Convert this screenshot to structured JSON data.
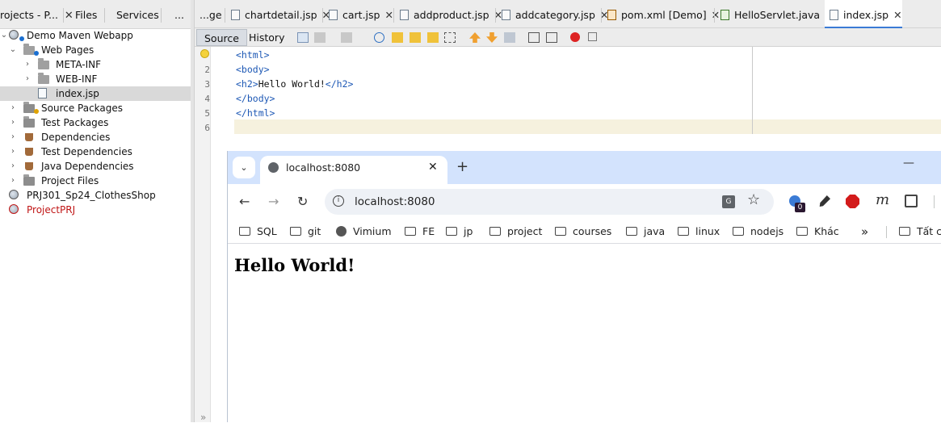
{
  "left_panel": {
    "tabs": [
      {
        "label": "rojects - P...",
        "close": "✕"
      },
      {
        "label": "Files"
      },
      {
        "label": "Services"
      },
      {
        "label": "..."
      }
    ],
    "tree": [
      {
        "label": "Demo Maven Webapp",
        "expander": "⌄",
        "icon": "maven-web-project-icon"
      },
      {
        "label": "Web Pages",
        "expander": "⌄",
        "icon": "web-pages-folder-icon"
      },
      {
        "label": "META-INF",
        "expander": "›",
        "icon": "folder-icon"
      },
      {
        "label": "WEB-INF",
        "expander": "›",
        "icon": "folder-icon"
      },
      {
        "label": "index.jsp",
        "icon": "jsp-file-icon",
        "selected": true
      },
      {
        "label": "Source Packages",
        "expander": "›",
        "icon": "source-packages-icon"
      },
      {
        "label": "Test Packages",
        "expander": "›",
        "icon": "test-packages-icon"
      },
      {
        "label": "Dependencies",
        "expander": "›",
        "icon": "dependencies-icon"
      },
      {
        "label": "Test Dependencies",
        "expander": "›",
        "icon": "test-dependencies-icon"
      },
      {
        "label": "Java Dependencies",
        "expander": "›",
        "icon": "java-dependencies-icon"
      },
      {
        "label": "Project Files",
        "expander": "›",
        "icon": "project-files-icon"
      },
      {
        "label": "PRJ301_Sp24_ClothesShop",
        "icon": "web-project-icon"
      },
      {
        "label": "ProjectPRJ",
        "icon": "broken-project-icon",
        "color": "#c01515"
      }
    ]
  },
  "editor": {
    "tabs": [
      {
        "label": "...ge"
      },
      {
        "label": "chartdetail.jsp",
        "close": "✕"
      },
      {
        "label": "cart.jsp",
        "close": "✕"
      },
      {
        "label": "addproduct.jsp",
        "close": "✕"
      },
      {
        "label": "addcategory.jsp",
        "close": "✕"
      },
      {
        "label": "pom.xml",
        "suffix": "[Demo]",
        "close": "✕"
      },
      {
        "label": "HelloServlet.java",
        "close": "✕"
      },
      {
        "label": "index.jsp",
        "close": "✕",
        "active": true
      }
    ],
    "views": {
      "source": "Source",
      "history": "History"
    },
    "line_numbers": [
      "2",
      "3",
      "4",
      "5",
      "6"
    ],
    "code": [
      {
        "tag_open": "<html>"
      },
      {
        "tag_open": "<body>"
      },
      {
        "tag_open": "<h2>",
        "text": "Hello World!",
        "tag_close": "</h2>"
      },
      {
        "tag_open": "</body>"
      },
      {
        "tag_open": "</html>"
      }
    ]
  },
  "browser": {
    "tab_title": "localhost:8080",
    "tab_close": "✕",
    "new_tab": "+",
    "minimize": "—",
    "url": "localhost:8080",
    "extension_badge": "0",
    "bookmarks": [
      {
        "label": "SQL",
        "icon": "folder"
      },
      {
        "label": "git",
        "icon": "folder"
      },
      {
        "label": "Vimium",
        "icon": "globe"
      },
      {
        "label": "FE",
        "icon": "folder"
      },
      {
        "label": "jp",
        "icon": "folder"
      },
      {
        "label": "project",
        "icon": "folder"
      },
      {
        "label": "courses",
        "icon": "folder"
      },
      {
        "label": "java",
        "icon": "folder"
      },
      {
        "label": "linux",
        "icon": "folder"
      },
      {
        "label": "nodejs",
        "icon": "folder"
      },
      {
        "label": "Khác",
        "icon": "folder"
      }
    ],
    "bookmarks_overflow": "»",
    "all_bookmarks": "Tất c",
    "page_heading": "Hello World!"
  }
}
